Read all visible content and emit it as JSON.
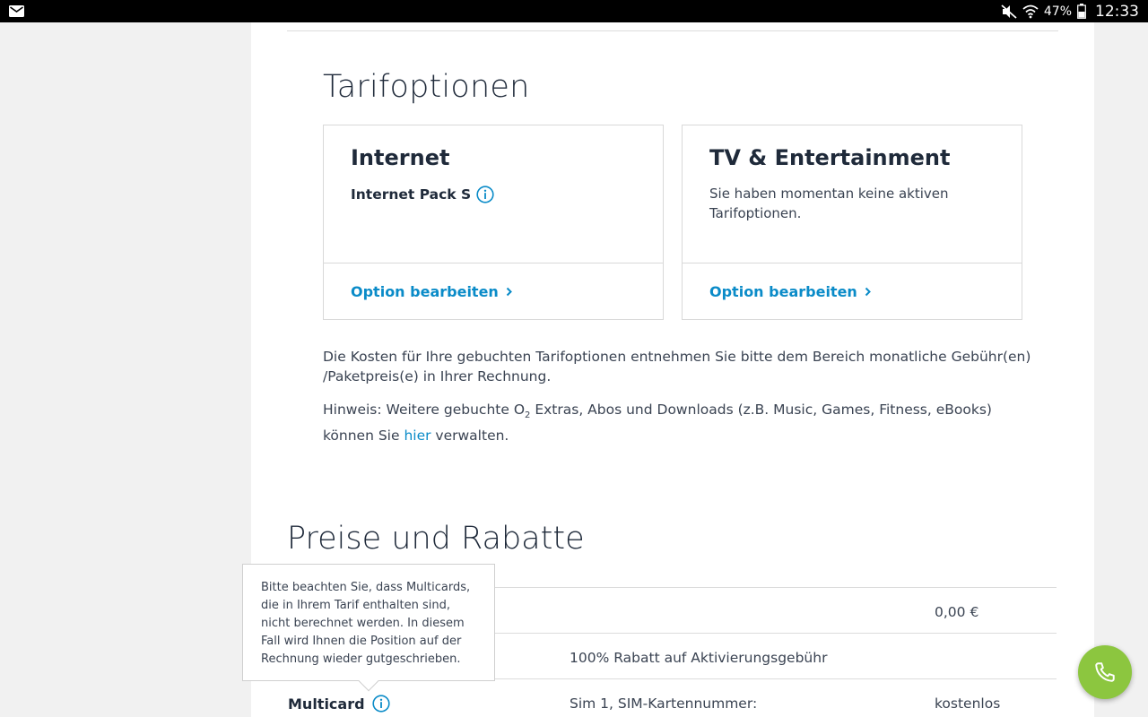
{
  "statusbar": {
    "battery": "47%",
    "time": "12:33",
    "icons": [
      "mail-icon",
      "mute-icon",
      "wifi-icon",
      "battery-icon"
    ]
  },
  "tarif": {
    "heading": "Tarifoptionen",
    "cards": [
      {
        "title": "Internet",
        "subtitle": "Internet Pack S",
        "link": "Option bearbeiten"
      },
      {
        "title": "TV & Entertainment",
        "description": "Sie haben momentan keine aktiven Tarifoptionen.",
        "link": "Option bearbeiten"
      }
    ],
    "note1": "Die Kosten für Ihre gebuchten Tarifoptionen entnehmen Sie bitte dem Bereich monatliche Gebühr(en) /Paketpreis(e) in Ihrer Rechnung.",
    "note2_prefix": "Hinweis: Weitere gebuchte O",
    "note2_sub": "2",
    "note2_mid": " Extras, Abos und Downloads (z.B. Music, Games, Fitness, eBooks) können Sie ",
    "note2_link": "hier",
    "note2_suffix": " verwalten."
  },
  "preise": {
    "heading": "Preise und Rabatte",
    "rows": [
      {
        "label": "",
        "desc": "",
        "value": "0,00 €"
      },
      {
        "label": "",
        "desc": "100% Rabatt auf Aktivierungsgebühr",
        "value": ""
      },
      {
        "label": "Multicard",
        "desc": "Sim 1, SIM-Kartennummer:",
        "value": "kostenlos"
      }
    ],
    "tooltip": "Bitte beachten Sie, dass Multicards, die in Ihrem Tarif enthalten sind, nicht berechnet werden. In diesem Fall wird Ihnen die Position auf der Rechnung wieder gutgeschrieben."
  },
  "colors": {
    "accent": "#0a8bc8",
    "fab": "#8cc63f",
    "text": "#1f2a3a"
  }
}
